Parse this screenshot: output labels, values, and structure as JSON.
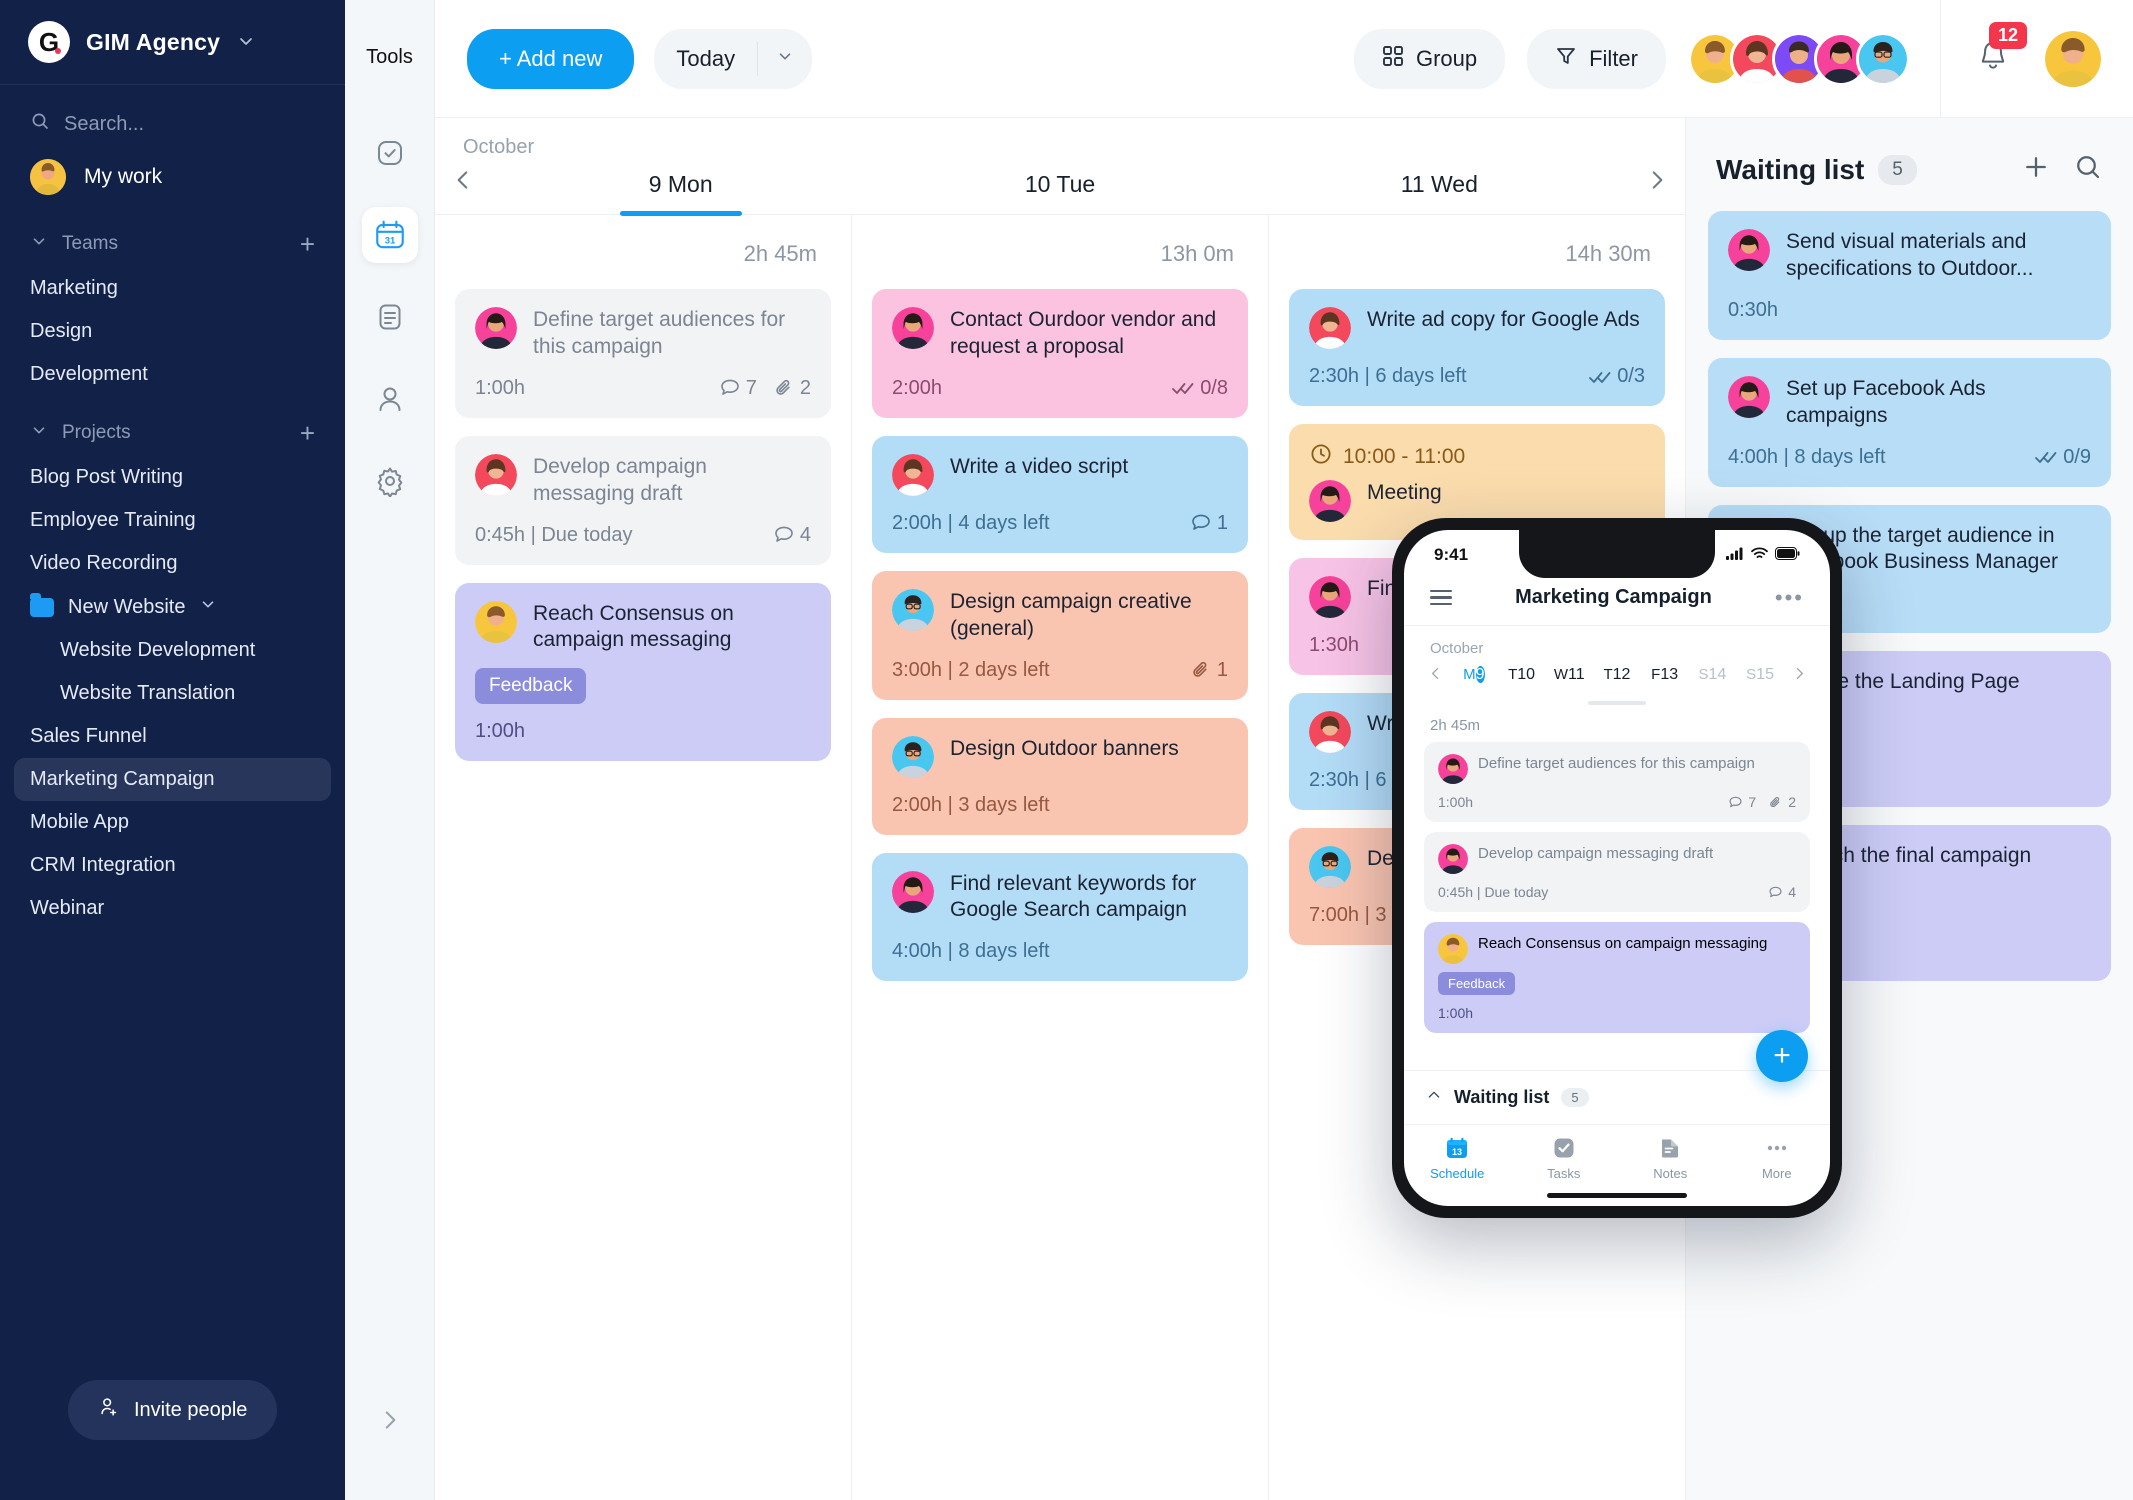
{
  "sidebar": {
    "brand": {
      "logo_letter": "G",
      "name": "GIM Agency",
      "chevron": "⌄"
    },
    "search_placeholder": "Search...",
    "my_work": "My work",
    "teams_label": "Teams",
    "teams": [
      "Marketing",
      "Design",
      "Development"
    ],
    "projects_label": "Projects",
    "projects": [
      "Blog Post Writing",
      "Employee Training",
      "Video Recording"
    ],
    "folder": {
      "name": "New Website",
      "children": [
        "Website Development",
        "Website Translation"
      ]
    },
    "projects_after": [
      "Sales Funnel",
      "Marketing Campaign",
      "Mobile App",
      "CRM Integration",
      "Webinar"
    ],
    "active_project": "Marketing Campaign",
    "invite_label": "Invite people"
  },
  "rail": {
    "title": "Tools",
    "items": [
      {
        "icon": "checkbox-icon",
        "selected": false
      },
      {
        "icon": "calendar-icon",
        "selected": true
      },
      {
        "icon": "notes-icon",
        "selected": false
      },
      {
        "icon": "person-icon",
        "selected": false
      },
      {
        "icon": "gear-icon",
        "selected": false
      }
    ],
    "collapse_icon": "chevron-right-icon"
  },
  "topbar": {
    "add_new": "+ Add new",
    "today": "Today",
    "today_chevron": "⌄",
    "group": "Group",
    "filter": "Filter",
    "notification_count": "12",
    "member_avatar_count": 5
  },
  "calendar": {
    "month": "October",
    "prev_icon": "chevron-left-icon",
    "next_icon": "chevron-right-icon",
    "days": [
      {
        "label": "9 Mon",
        "selected": true,
        "total": "2h 45m"
      },
      {
        "label": "10 Tue",
        "selected": false,
        "total": "13h 0m"
      },
      {
        "label": "11 Wed",
        "selected": false,
        "total": "14h 30m"
      }
    ],
    "columns": [
      {
        "day": "9 Mon",
        "cards": [
          {
            "color": "c-grey",
            "title": "Define target audiences for this campaign",
            "time": "1:00h",
            "comments": "7",
            "attachments": "2",
            "avatar": "pink"
          },
          {
            "color": "c-grey",
            "title": "Develop campaign messaging draft",
            "time": "0:45h | Due today",
            "comments": "4",
            "avatar": "red"
          },
          {
            "color": "c-purple",
            "title": "Reach Consensus on campaign messaging",
            "tag": "Feedback",
            "time": "1:00h",
            "avatar": "yellow"
          }
        ]
      },
      {
        "day": "10 Tue",
        "cards": [
          {
            "color": "c-pink",
            "title": "Contact Ourdoor vendor and request a proposal",
            "time": "2:00h",
            "subtasks": "0/8",
            "avatar": "pink"
          },
          {
            "color": "c-blue",
            "title": "Write a video script",
            "time": "2:00h | 4 days left",
            "comments": "1",
            "avatar": "red"
          },
          {
            "color": "c-peach",
            "title": "Design campaign creative (general)",
            "time": "3:00h | 2 days left",
            "attachments": "1",
            "avatar": "cyan"
          },
          {
            "color": "c-peach",
            "title": "Design Outdoor banners",
            "time": "2:00h | 3 days left",
            "avatar": "cyan"
          },
          {
            "color": "c-blue",
            "title": "Find relevant keywords for Google Search campaign",
            "time": "4:00h | 8 days left",
            "avatar": "pink"
          }
        ]
      },
      {
        "day": "11 Wed",
        "cards": [
          {
            "color": "c-blue",
            "title": "Write ad copy for Google Ads",
            "time": "2:30h | 6 days left",
            "subtasks": "0/3",
            "avatar": "red"
          },
          {
            "color": "c-orange",
            "timerange": "10:00 - 11:00",
            "title": "Meeting",
            "avatar": "pink"
          },
          {
            "color": "c-pink2",
            "title": "Find com",
            "time": "1:30h",
            "avatar": "pink"
          },
          {
            "color": "c-blue",
            "title": "Write Fac",
            "time": "2:30h | 6",
            "avatar": "red"
          },
          {
            "color": "c-peach",
            "title": "Des",
            "time": "7:00h | 3 d",
            "avatar": "cyan"
          }
        ]
      }
    ]
  },
  "waiting_list": {
    "title": "Waiting list",
    "count": "5",
    "add_icon": "plus-icon",
    "search_icon": "search-icon",
    "cards": [
      {
        "color": "c-blue2",
        "title": "Send visual materials and specifications to Outdoor...",
        "time": "0:30h",
        "avatar": "pink"
      },
      {
        "color": "c-blue2",
        "title": "Set up Facebook Ads campaigns",
        "time": "4:00h | 8 days left",
        "subtasks": "0/9",
        "avatar": "pink"
      },
      {
        "color": "c-blue2",
        "title": "Set up the target audience in Facebook Business Manager",
        "time": "days left",
        "avatar": "pink"
      },
      {
        "color": "c-purple",
        "title": "Create the Landing Page",
        "avatar": "yellow"
      },
      {
        "color": "c-purple",
        "title": "Launch the final campaign",
        "avatar": "yellow"
      }
    ]
  },
  "phone": {
    "status_time": "9:41",
    "title": "Marketing Campaign",
    "menu_icon": "hamburger-icon",
    "more_icon": "more-dots-icon",
    "month": "October",
    "week": [
      {
        "dw": "M",
        "dn": "9",
        "selected": true,
        "off": false
      },
      {
        "dw": "T",
        "dn": "10",
        "selected": false,
        "off": false
      },
      {
        "dw": "W",
        "dn": "11",
        "selected": false,
        "off": false
      },
      {
        "dw": "T",
        "dn": "12",
        "selected": false,
        "off": false
      },
      {
        "dw": "F",
        "dn": "13",
        "selected": false,
        "off": false
      },
      {
        "dw": "S",
        "dn": "14",
        "selected": false,
        "off": true
      },
      {
        "dw": "S",
        "dn": "15",
        "selected": false,
        "off": true
      }
    ],
    "day_total": "2h 45m",
    "cards": [
      {
        "color": "c-grey",
        "title": "Define target audiences for this campaign",
        "time": "1:00h",
        "comments": "7",
        "attachments": "2",
        "avatar": "pink"
      },
      {
        "color": "c-grey",
        "title": "Develop campaign messaging draft",
        "time": "0:45h | Due today",
        "comments": "4",
        "avatar": "pink"
      },
      {
        "color": "c-purple",
        "title": "Reach Consensus on campaign messaging",
        "tag": "Feedback",
        "time": "1:00h",
        "avatar": "yellow"
      }
    ],
    "fab": "+",
    "waiting_title": "Waiting list",
    "waiting_count": "5",
    "collapse_icon": "chevron-up-icon",
    "tabs": [
      {
        "label": "Schedule",
        "icon": "calendar-13-icon",
        "selected": true
      },
      {
        "label": "Tasks",
        "icon": "check-square-icon",
        "selected": false
      },
      {
        "label": "Notes",
        "icon": "note-icon",
        "selected": false
      },
      {
        "label": "More",
        "icon": "more-dots-icon",
        "selected": false
      }
    ]
  },
  "colors": {
    "accent": "#0c9ef0",
    "sidebar_bg": "#122148",
    "badge_red": "#f4364c",
    "tag_feedback": "#8c8cdd"
  }
}
